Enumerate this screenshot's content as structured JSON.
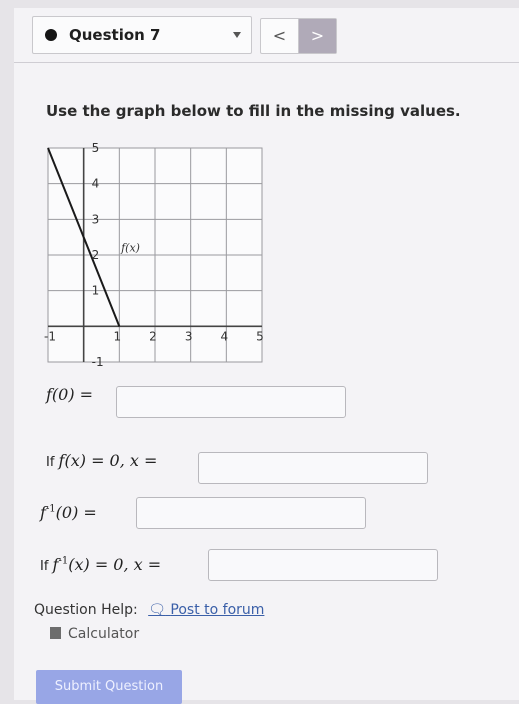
{
  "header": {
    "question_label": "Question 7",
    "prev_symbol": "<",
    "next_symbol": ">"
  },
  "prompt": "Use the graph below to fill in the missing values.",
  "graph": {
    "x_ticks": [
      "-1",
      "1",
      "2",
      "3",
      "4",
      "5"
    ],
    "y_ticks": [
      "5",
      "4",
      "3",
      "2",
      "1",
      "-1"
    ],
    "function_label": "f(x)",
    "chart_data": {
      "type": "line",
      "x_range": [
        -1,
        5
      ],
      "y_range": [
        -1,
        5
      ],
      "grid": true,
      "series": [
        {
          "name": "f(x)",
          "x": [
            -1,
            1
          ],
          "y": [
            5,
            0
          ]
        }
      ]
    }
  },
  "questions": [
    {
      "lhs_prefix": "",
      "lhs": "f(0) =",
      "value": ""
    },
    {
      "lhs_prefix": "If ",
      "lhs": "f(x) = 0, x =",
      "value": ""
    },
    {
      "lhs_prefix": "",
      "lhs_func": "f",
      "lhs_sup": "-1",
      "lhs_rest": "(0) =",
      "value": ""
    },
    {
      "lhs_prefix": "If ",
      "lhs_func": "f",
      "lhs_sup": "-1",
      "lhs_rest": "(x) = 0, x =",
      "value": ""
    }
  ],
  "help": {
    "label": "Question Help:",
    "forum_link": "Post to forum",
    "calculator": "Calculator"
  },
  "submit_label": "Submit Question",
  "colors": {
    "link": "#3a5fa8",
    "submit_bg": "#98a6e6",
    "next_btn_bg": "#b0aab8"
  }
}
